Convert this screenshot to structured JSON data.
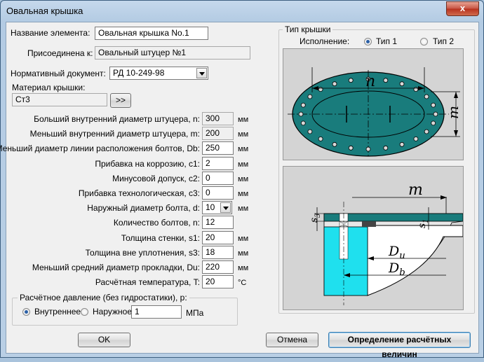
{
  "window": {
    "title": "Овальная крышка",
    "close_glyph": "x"
  },
  "fields": {
    "name_label": "Название элемента:",
    "name_value": "Овальная крышка No.1",
    "attached_label": "Присоединена к:",
    "attached_value": "Овальный штуцер №1",
    "normdoc_label": "Нормативный документ:",
    "normdoc_value": "РД 10-249-98",
    "material_label": "Материал крышки:",
    "material_value": "Ст3",
    "material_button": ">>"
  },
  "params": [
    {
      "label": "Больший внутренний диаметр штуцера, n:",
      "value": "300",
      "unit": "мм",
      "readonly": true
    },
    {
      "label": "Меньший внутренний диаметр штуцера, m:",
      "value": "200",
      "unit": "мм",
      "readonly": true
    },
    {
      "label": "Меньший диаметр линии расположения болтов, Db:",
      "value": "250",
      "unit": "мм"
    },
    {
      "label": "Прибавка на коррозию, c1:",
      "value": "2",
      "unit": "мм"
    },
    {
      "label": "Минусовой допуск, c2:",
      "value": "0",
      "unit": "мм"
    },
    {
      "label": "Прибавка технологическая, c3:",
      "value": "0",
      "unit": "мм"
    },
    {
      "label": "Наружный диаметр болта, d:",
      "value": "10",
      "unit": "мм",
      "combo": true
    },
    {
      "label": "Количество болтов, n:",
      "value": "12",
      "unit": ""
    },
    {
      "label": "Толщина стенки, s1:",
      "value": "20",
      "unit": "мм"
    },
    {
      "label": "Толщина вне уплотнения, s3:",
      "value": "18",
      "unit": "мм"
    },
    {
      "label": "Меньший средний диаметр прокладки, Du:",
      "value": "220",
      "unit": "мм"
    },
    {
      "label": "Расчётная температура, T:",
      "value": "20",
      "unit": "°С"
    }
  ],
  "pressure": {
    "group_title": "Расчётное давление (без гидростатики), p:",
    "internal": "Внутреннее",
    "external": "Наружное",
    "value": "1",
    "unit": "МПа",
    "selected": "internal"
  },
  "cover_type": {
    "group_title": "Тип крышки",
    "exec_label": "Исполнение:",
    "type1": "Тип 1",
    "type2": "Тип 2",
    "selected": "type1"
  },
  "drawing_top": {
    "dim_n": "n",
    "dim_m": "m"
  },
  "drawing_section": {
    "dim_m": "m",
    "dim_s3": "s3",
    "dim_s1": "s1",
    "dim_du": "Du",
    "dim_db": "Db"
  },
  "buttons": {
    "ok": "OK",
    "cancel": "Отмена",
    "determine": "Определение расчётных величин"
  },
  "colors": {
    "teal": "#197c7c",
    "cyan": "#1fe0ee",
    "panel": "#f0f0f0"
  }
}
